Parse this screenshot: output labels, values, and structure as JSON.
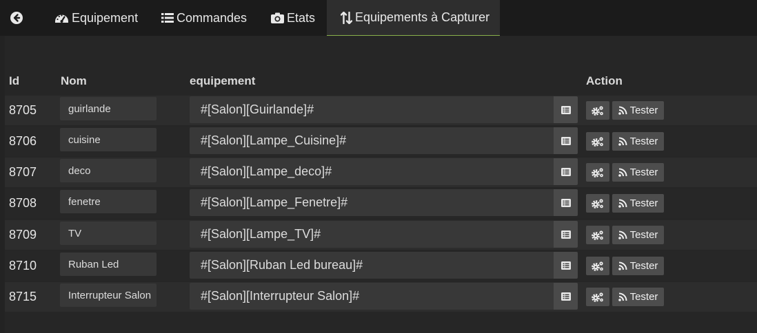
{
  "tabs": [
    {
      "label": "",
      "icon": "back-arrow-icon"
    },
    {
      "label": "Equipement",
      "icon": "dashboard-icon"
    },
    {
      "label": "Commandes",
      "icon": "list-icon"
    },
    {
      "label": "Etats",
      "icon": "camera-icon"
    },
    {
      "label": "Equipements à Capturer",
      "icon": "sort-arrows-icon",
      "active": true
    }
  ],
  "table": {
    "headers": {
      "id": "Id",
      "nom": "Nom",
      "equipement": "equipement",
      "action": "Action"
    },
    "rows": [
      {
        "id": "8705",
        "nom": "guirlande",
        "equipement": "#[Salon][Guirlande]#"
      },
      {
        "id": "8706",
        "nom": "cuisine",
        "equipement": "#[Salon][Lampe_Cuisine]#"
      },
      {
        "id": "8707",
        "nom": "deco",
        "equipement": "#[Salon][Lampe_deco]#"
      },
      {
        "id": "8708",
        "nom": "fenetre",
        "equipement": "#[Salon][Lampe_Fenetre]#"
      },
      {
        "id": "8709",
        "nom": "TV",
        "equipement": "#[Salon][Lampe_TV]#"
      },
      {
        "id": "8710",
        "nom": "Ruban Led",
        "equipement": "#[Salon][Ruban Led bureau]#"
      },
      {
        "id": "8715",
        "nom": "Interrupteur Salon",
        "equipement": "#[Salon][Interrupteur Salon]#"
      }
    ],
    "test_label": "Tester"
  },
  "colors": {
    "active_tab_underline": "#8ab14b",
    "background": "#232323"
  }
}
